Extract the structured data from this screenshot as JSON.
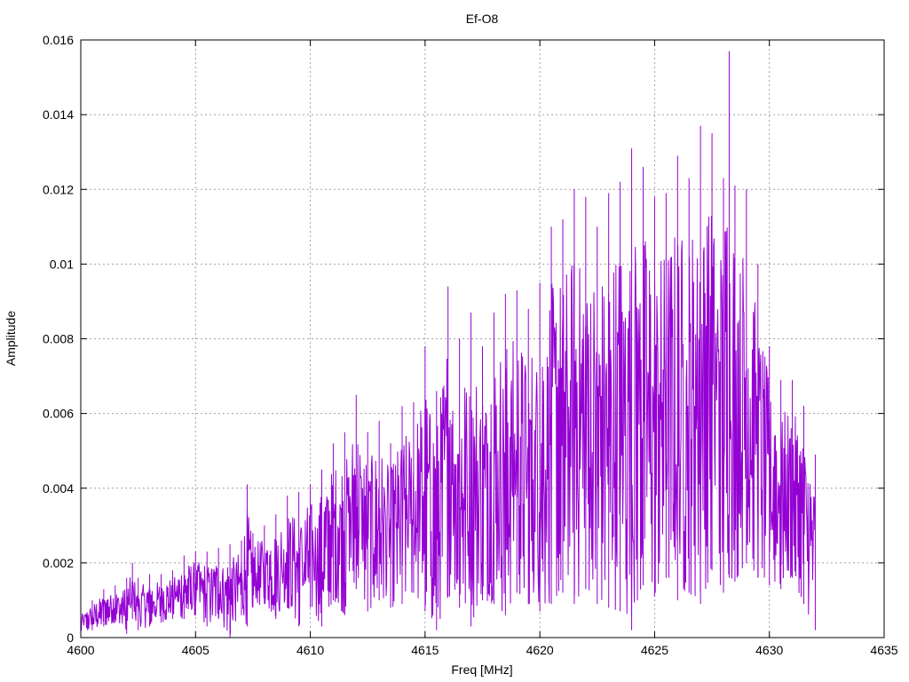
{
  "chart_data": {
    "type": "line",
    "title": "Ef-O8",
    "xlabel": "Freq [MHz]",
    "ylabel": "Amplitude",
    "xlim": [
      4600,
      4635
    ],
    "ylim": [
      0,
      0.016
    ],
    "xticks": [
      4600,
      4605,
      4610,
      4615,
      4620,
      4625,
      4630,
      4635
    ],
    "yticks": [
      0,
      0.002,
      0.004,
      0.006,
      0.008,
      0.01,
      0.012,
      0.014,
      0.016
    ],
    "xtick_labels": [
      "4600",
      "4605",
      "4610",
      "4615",
      "4620",
      "4625",
      "4630",
      "4635"
    ],
    "ytick_labels": [
      "0",
      "0.002",
      "0.004",
      "0.006",
      "0.008",
      "0.01",
      "0.012",
      "0.014",
      "0.016"
    ],
    "grid": true,
    "series": [
      {
        "color": "#9400d3",
        "x": [
          4600.0,
          4600.5,
          4601.0,
          4601.5,
          4602.0,
          4602.25,
          4602.5,
          4603.0,
          4603.5,
          4604.0,
          4604.5,
          4605.0,
          4605.5,
          4606.0,
          4606.5,
          4607.0,
          4607.25,
          4607.5,
          4608.0,
          4608.5,
          4609.0,
          4609.5,
          4610.0,
          4610.5,
          4611.0,
          4611.5,
          4612.0,
          4612.5,
          4613.0,
          4613.5,
          4614.0,
          4614.5,
          4615.0,
          4615.5,
          4616.0,
          4616.5,
          4617.0,
          4617.5,
          4618.0,
          4618.5,
          4619.0,
          4619.5,
          4620.0,
          4620.5,
          4621.0,
          4621.5,
          4622.0,
          4622.5,
          4623.0,
          4623.5,
          4624.0,
          4624.5,
          4625.0,
          4625.5,
          4626.0,
          4626.5,
          4627.0,
          4627.5,
          4628.0,
          4628.25,
          4628.5,
          4629.0,
          4629.5,
          4630.0,
          4630.5,
          4631.0,
          4631.5,
          4632.0
        ],
        "y_high": [
          0.0007,
          0.001,
          0.0013,
          0.0014,
          0.0016,
          0.002,
          0.0016,
          0.0017,
          0.0017,
          0.0018,
          0.0022,
          0.0023,
          0.0023,
          0.0024,
          0.0025,
          0.0026,
          0.0041,
          0.0028,
          0.003,
          0.0033,
          0.0038,
          0.0039,
          0.0041,
          0.0045,
          0.0052,
          0.0055,
          0.0065,
          0.0055,
          0.0058,
          0.0052,
          0.0062,
          0.0063,
          0.0078,
          0.0066,
          0.0094,
          0.008,
          0.0087,
          0.0078,
          0.0087,
          0.0092,
          0.0093,
          0.0088,
          0.0095,
          0.011,
          0.0112,
          0.012,
          0.0118,
          0.011,
          0.0119,
          0.0122,
          0.0131,
          0.0126,
          0.0118,
          0.0119,
          0.0129,
          0.0123,
          0.0137,
          0.0135,
          0.0123,
          0.0157,
          0.0121,
          0.012,
          0.01,
          0.0078,
          0.0069,
          0.0069,
          0.0062,
          0.0049
        ],
        "y_low": [
          0.0001,
          0.0002,
          0.0003,
          0.0004,
          0.0001,
          0.0005,
          0.0002,
          0.0003,
          0.0004,
          0.0005,
          0.0005,
          0.0006,
          0.0003,
          0.0005,
          0.0,
          0.0006,
          0.0003,
          0.0008,
          0.0009,
          0.0005,
          0.0008,
          0.0003,
          0.0008,
          0.0003,
          0.001,
          0.0006,
          0.0013,
          0.0007,
          0.001,
          0.0008,
          0.0009,
          0.0012,
          0.0007,
          0.0002,
          0.0011,
          0.0008,
          0.0003,
          0.001,
          0.0009,
          0.0006,
          0.0012,
          0.0009,
          0.0007,
          0.0009,
          0.0012,
          0.0009,
          0.0013,
          0.0009,
          0.0008,
          0.0007,
          0.0002,
          0.0014,
          0.0011,
          0.0016,
          0.001,
          0.0012,
          0.0009,
          0.0018,
          0.0012,
          0.0016,
          0.0015,
          0.002,
          0.0016,
          0.0014,
          0.0013,
          0.0016,
          0.0009,
          0.0002
        ]
      }
    ]
  }
}
